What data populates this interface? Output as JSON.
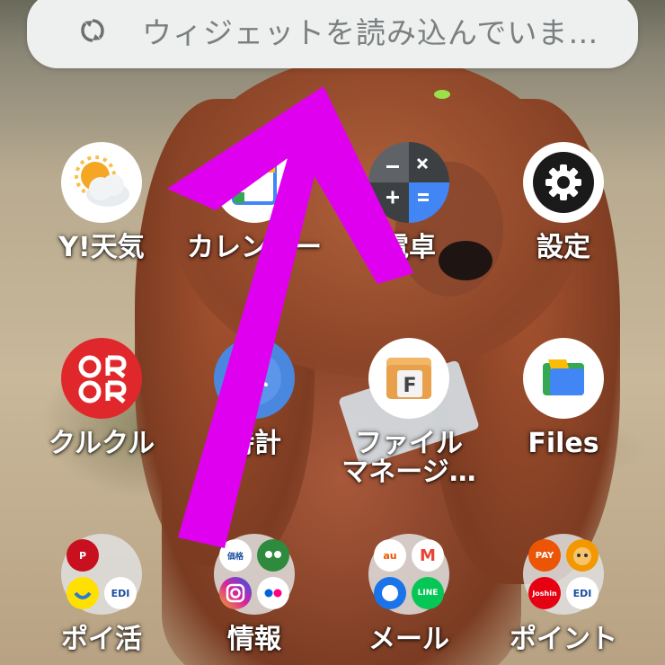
{
  "search_bar": {
    "text": "ウィジェットを読み込んでいま…",
    "icon": "sync-icon"
  },
  "apps": [
    {
      "label": "Y!天気",
      "icon": "weather-icon"
    },
    {
      "label": "カレンダー",
      "icon": "calendar-icon"
    },
    {
      "label": "電卓",
      "icon": "calculator-icon"
    },
    {
      "label": "設定",
      "icon": "gear-icon"
    },
    {
      "label": "クルクル",
      "icon": "qr-icon"
    },
    {
      "label": "時計",
      "icon": "clock-icon"
    },
    {
      "label": "ファイル\nマネージ…",
      "icon": "file-manager-icon"
    },
    {
      "label": "Files",
      "icon": "files-icon"
    }
  ],
  "folders": [
    {
      "label": "ポイ活",
      "minis": [
        "P CLUB",
        "",
        "",
        "EDION"
      ]
    },
    {
      "label": "情報",
      "minis": [
        "価格.com",
        "",
        "",
        ""
      ]
    },
    {
      "label": "メール",
      "minis": [
        "au",
        "M",
        "",
        "LINE"
      ]
    },
    {
      "label": "ポイント",
      "minis": [
        "au PAY",
        "",
        "Joshin",
        "EDION"
      ]
    }
  ],
  "colors": {
    "arrow": "#e000f0",
    "label": "#ffffff",
    "search_bg": "#eef0ef"
  }
}
